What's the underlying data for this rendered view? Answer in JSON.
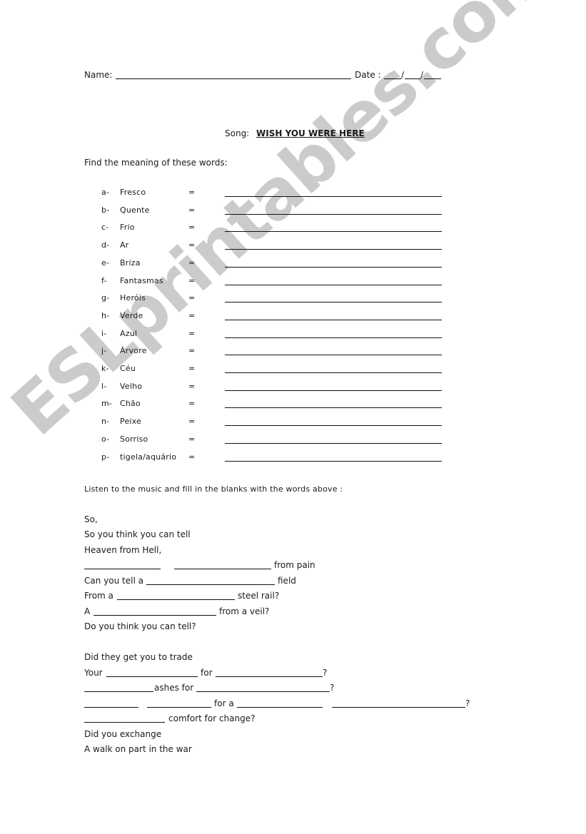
{
  "header": {
    "name_label": "Name:",
    "date_label": "Date :"
  },
  "song": {
    "label": "Song:",
    "title": "WISH YOU WERE HERE"
  },
  "vocab": {
    "instruction": "Find the meaning of these words:",
    "equals": "=",
    "items": [
      {
        "letter": "a-",
        "word": "Fresco"
      },
      {
        "letter": "b-",
        "word": "Quente"
      },
      {
        "letter": "c-",
        "word": "Frio"
      },
      {
        "letter": "d-",
        "word": "Ar"
      },
      {
        "letter": "e-",
        "word": "Briza"
      },
      {
        "letter": "f-",
        "word": "Fantasmas"
      },
      {
        "letter": "g-",
        "word": "Heróis"
      },
      {
        "letter": "h-",
        "word": "Verde"
      },
      {
        "letter": "i-",
        "word": "Azul"
      },
      {
        "letter": "j-",
        "word": "Árvore"
      },
      {
        "letter": "k-",
        "word": "Céu"
      },
      {
        "letter": "l-",
        "word": "Velho"
      },
      {
        "letter": "m-",
        "word": "Chão"
      },
      {
        "letter": "n-",
        "word": "Peixe"
      },
      {
        "letter": "o-",
        "word": "Sorriso"
      },
      {
        "letter": "p-",
        "word": "tigela/aquário"
      }
    ]
  },
  "lyrics": {
    "instruction": "Listen to the music and fill in the  blanks with the words above :",
    "lines": {
      "l1": "So,",
      "l2": "So you think you can tell",
      "l3": "Heaven from Hell,",
      "l4_end": "from pain",
      "l5_start": "Can you tell a",
      "l5_end": "field",
      "l6_start": "From a",
      "l6_end": "steel rail?",
      "l7_start": "A",
      "l7_end": "from a veil?",
      "l8": "Do you think you can tell?",
      "l9": "Did they get you to trade",
      "l10_start": "Your",
      "l10_mid": "for",
      "l10_end": "?",
      "l11_mid": "ashes for",
      "l11_end": "?",
      "l12_mid": "for a",
      "l12_end": "?",
      "l13_end": "comfort for change?",
      "l14": "Did you exchange",
      "l15": "A walk on part in the war"
    }
  },
  "watermark": {
    "text": "ESLprintables.com"
  }
}
